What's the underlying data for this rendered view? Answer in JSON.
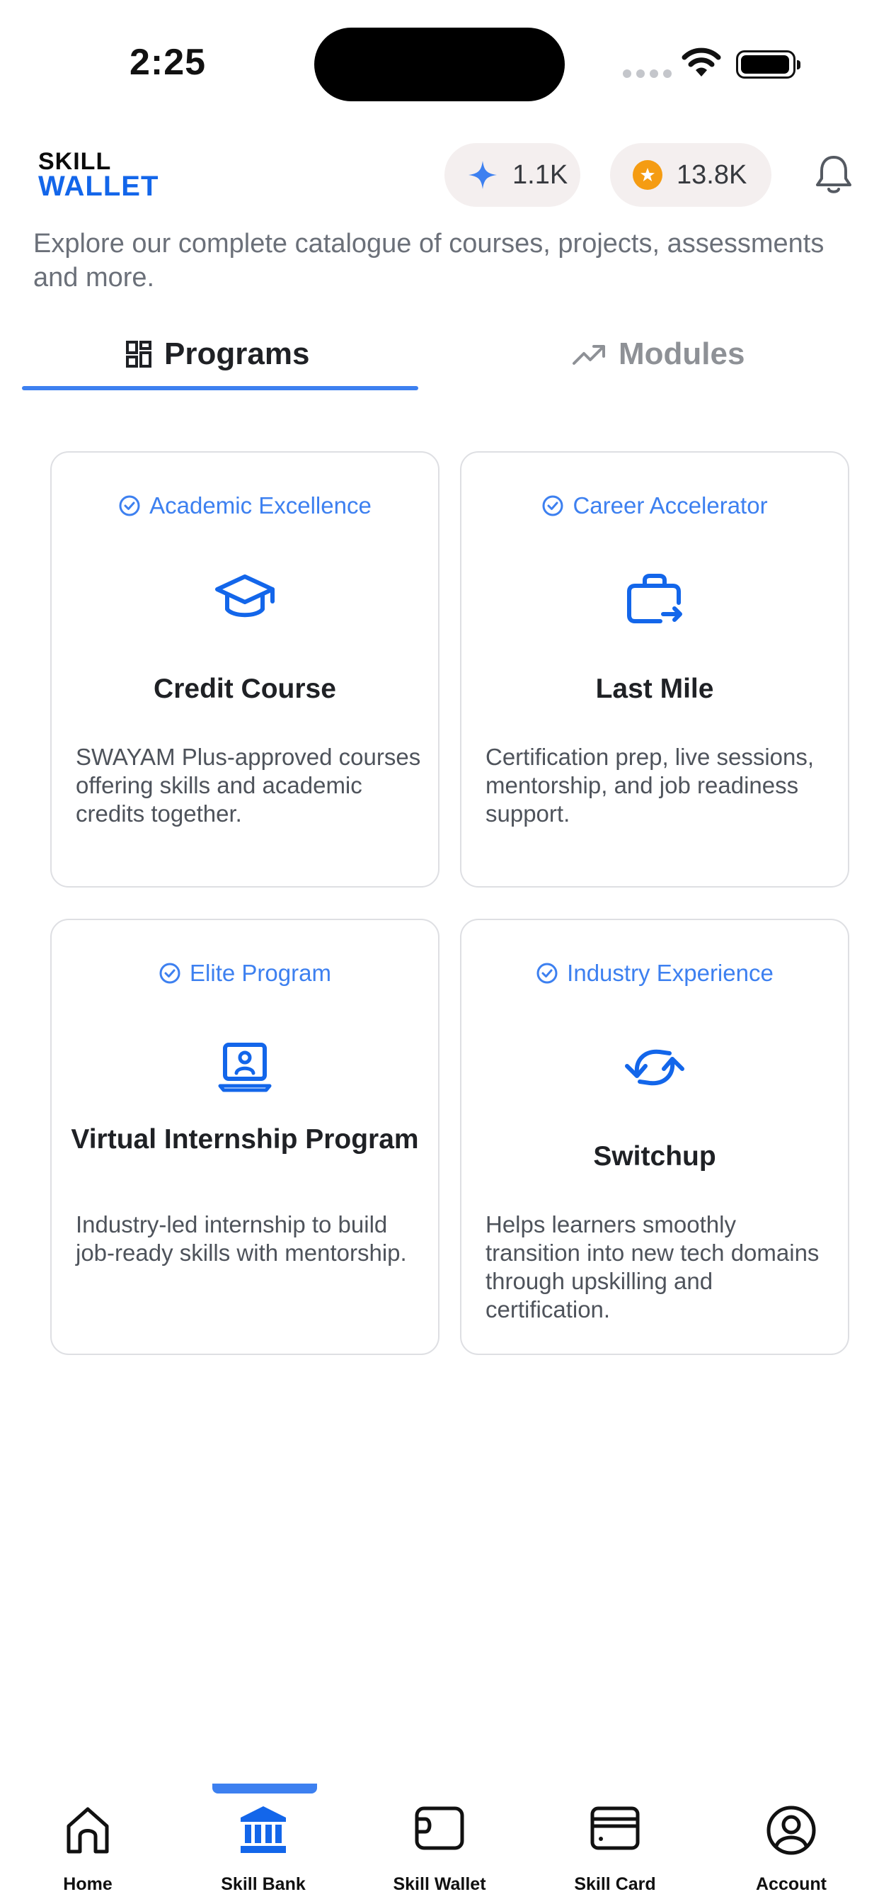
{
  "status_bar": {
    "time": "2:25"
  },
  "header": {
    "logo_line1": "SKILL",
    "logo_line2": "WALLET",
    "sparkle_count": "1.1K",
    "coin_count": "13.8K"
  },
  "subtitle": "Explore our complete catalogue of courses, projects, assessments and more.",
  "tabs": [
    {
      "label": "Programs",
      "active": true
    },
    {
      "label": "Modules",
      "active": false
    }
  ],
  "cards": [
    {
      "tag": "Academic Excellence",
      "title": "Credit Course",
      "description": "SWAYAM Plus-approved courses offering skills and academic credits together.",
      "icon": "graduation-cap-icon"
    },
    {
      "tag": "Career Accelerator",
      "title": "Last Mile",
      "description": "Certification prep, live sessions, mentorship, and job readiness support.",
      "icon": "briefcase-arrow-icon"
    },
    {
      "tag": "Elite Program",
      "title": "Virtual Internship Program",
      "description": "Industry-led internship to build job-ready skills with mentorship.",
      "icon": "laptop-user-icon"
    },
    {
      "tag": "Industry Experience",
      "title": "Switchup",
      "description": "Helps learners smoothly transition into new tech domains through upskilling and certification.",
      "icon": "refresh-arrows-icon"
    }
  ],
  "bottom_nav": [
    {
      "label": "Home",
      "icon": "home-icon"
    },
    {
      "label": "Skill Bank",
      "icon": "bank-icon",
      "active": true
    },
    {
      "label": "Skill Wallet",
      "icon": "wallet-icon"
    },
    {
      "label": "Skill Card",
      "icon": "card-icon"
    },
    {
      "label": "Account",
      "icon": "account-icon"
    }
  ],
  "colors": {
    "accent": "#3d80f0",
    "icon_blue": "#1366ea",
    "coin": "#f59c12"
  }
}
